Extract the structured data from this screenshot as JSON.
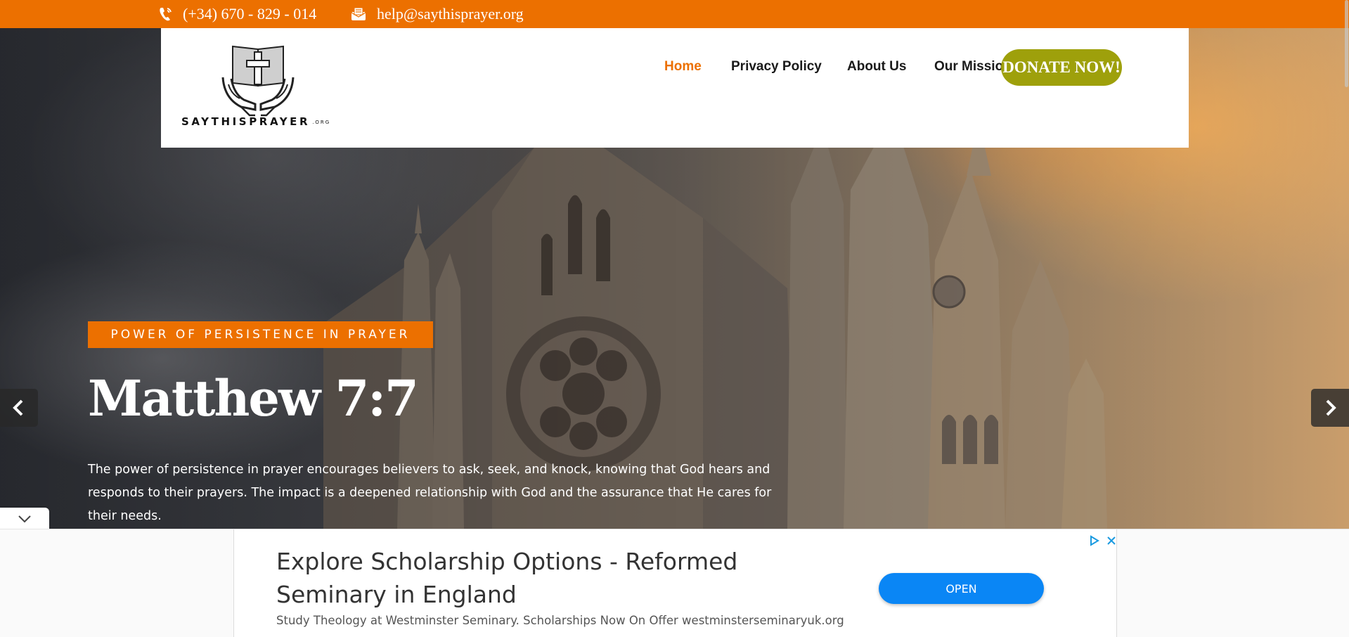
{
  "topbar": {
    "phone": "(+34) 670 - 829 - 014",
    "email": "help@saythisprayer.org",
    "phone_icon": "phone-icon",
    "email_icon": "envelope-icon",
    "color": "#ec7000"
  },
  "header": {
    "logo_text": "SAYTHISPRAYER",
    "logo_suffix": ".ORG",
    "nav": [
      {
        "label": "Home",
        "active": true
      },
      {
        "label": "Privacy Policy"
      },
      {
        "label": "About Us"
      },
      {
        "label": "Our Mission"
      }
    ],
    "donate_label": "DONATE NOW!",
    "donate_color": "#9ea00b"
  },
  "slide": {
    "tag": "POWER OF PERSISTENCE IN PRAYER",
    "title": "Matthew 7:7",
    "text": "The power of persistence in prayer encourages believers to ask, seek, and knock, knowing that God hears and responds to their prayers. The impact is a deepened relationship with God and the assurance that He cares for their needs.",
    "prev_icon": "chevron-left-icon",
    "next_icon": "chevron-right-icon"
  },
  "ad": {
    "headline": "Explore Scholarship Options - Reformed Seminary in England",
    "description": "Study Theology at Westminster Seminary. Scholarships Now On Offer westminsterseminaryuk.org",
    "button_label": "OPEN",
    "button_color": "#0a86f5"
  }
}
